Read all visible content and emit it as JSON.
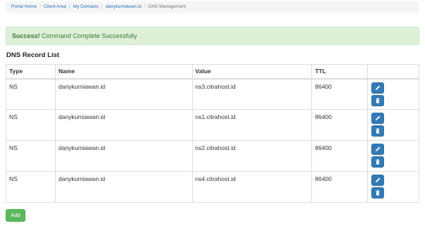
{
  "breadcrumb": {
    "items": [
      "Portal Home",
      "Client Area",
      "My Domains",
      "danykurniawan.id"
    ],
    "active": "DNS Management",
    "separator": "/"
  },
  "alert": {
    "strong": "Success!",
    "message": "Command Complete Successfully"
  },
  "section_title": "DNS Record List",
  "table": {
    "headers": [
      "Type",
      "Name",
      "Value",
      "TTL"
    ],
    "rows": [
      {
        "type": "NS",
        "name": "danykurniawan.id",
        "value": "ns3.citrahost.id",
        "ttl": "86400"
      },
      {
        "type": "NS",
        "name": "danykurniawan.id",
        "value": "ns1.citrahost.id",
        "ttl": "86400"
      },
      {
        "type": "NS",
        "name": "danykurniawan.id",
        "value": "ns2.citrahost.id",
        "ttl": "86400"
      },
      {
        "type": "NS",
        "name": "danykurniawan.id",
        "value": "ns4.citrahost.id",
        "ttl": "86400"
      }
    ],
    "row_actions": [
      "pencil-icon",
      "trash-icon"
    ]
  },
  "add_button": "Add",
  "colors": {
    "link": "#2a6fb5",
    "success_bg": "#dff0d8",
    "success_text": "#3c763d",
    "primary": "#337ab7",
    "add_green": "#5cb85c"
  }
}
